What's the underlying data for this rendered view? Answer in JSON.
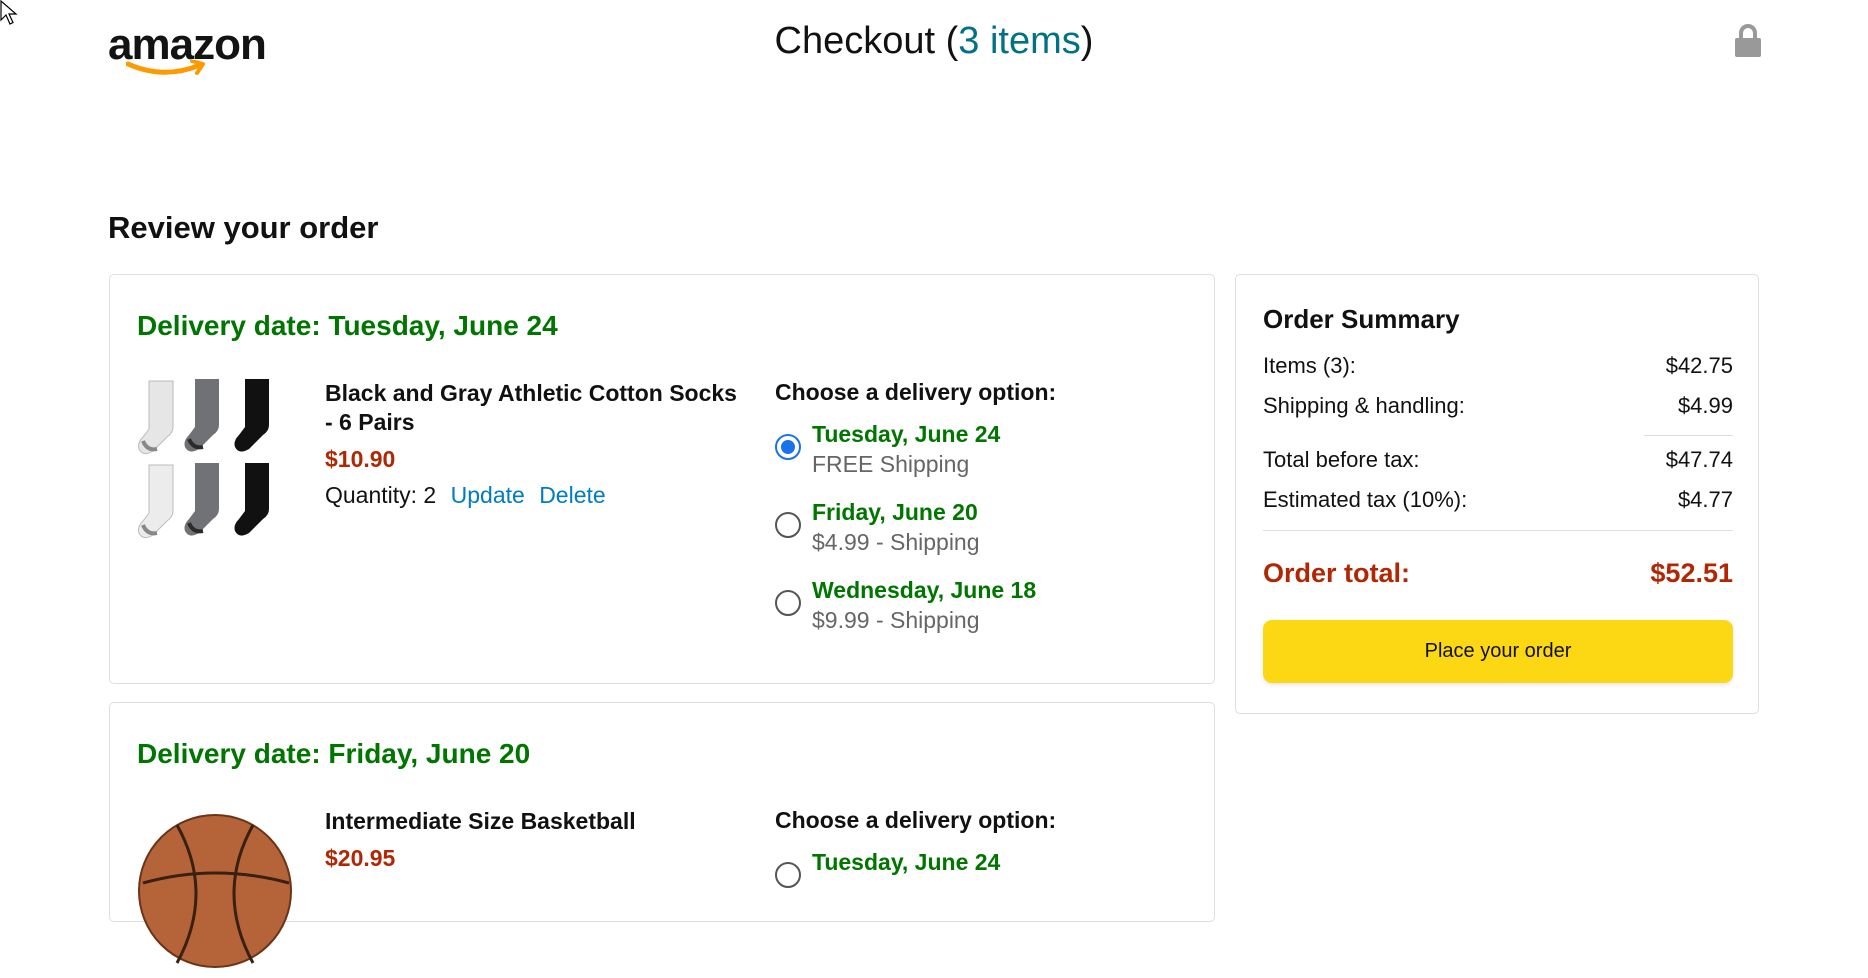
{
  "header": {
    "logo_text": "amazon",
    "checkout_prefix": "Checkout (",
    "items_count_label": "3 items",
    "checkout_suffix": ")",
    "lock_icon": "lock-icon"
  },
  "page": {
    "section_title": "Review your order"
  },
  "orders": [
    {
      "delivery_date": "Delivery date: Tuesday, June 24",
      "product_name": "Black and Gray Athletic Cotton Socks - 6 Pairs",
      "price": "$10.90",
      "quantity_label": "Quantity: 2",
      "update_label": "Update",
      "delete_label": "Delete",
      "options_title": "Choose a delivery option:",
      "options": [
        {
          "date": "Tuesday, June 24",
          "price": "FREE Shipping",
          "selected": true
        },
        {
          "date": "Friday, June 20",
          "price": "$4.99 - Shipping",
          "selected": false
        },
        {
          "date": "Wednesday, June 18",
          "price": "$9.99 - Shipping",
          "selected": false
        }
      ]
    },
    {
      "delivery_date": "Delivery date: Friday, June 20",
      "product_name": "Intermediate Size Basketball",
      "price": "$20.95",
      "options_title": "Choose a delivery option:",
      "options": [
        {
          "date": "Tuesday, June 24",
          "selected": false
        }
      ]
    }
  ],
  "summary": {
    "title": "Order Summary",
    "items_label": "Items (3):",
    "items_value": "$42.75",
    "shipping_label": "Shipping & handling:",
    "shipping_value": "$4.99",
    "before_tax_label": "Total before tax:",
    "before_tax_value": "$47.74",
    "tax_label": "Estimated tax (10%):",
    "tax_value": "$4.77",
    "total_label": "Order total:",
    "total_value": "$52.51",
    "place_order_label": "Place your order"
  },
  "colors": {
    "delivery_green": "#007600",
    "price_red": "#b12704",
    "link_blue": "#017cc3",
    "button_yellow": "#fcd814",
    "items_teal": "#017185"
  }
}
